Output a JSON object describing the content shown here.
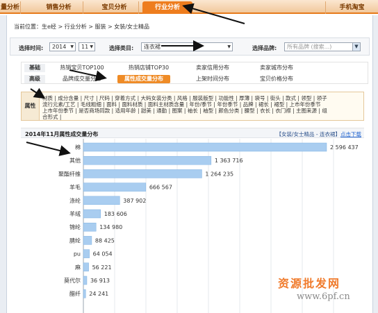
{
  "nav": {
    "tabs": [
      {
        "label": "量分析"
      },
      {
        "label": "销售分析"
      },
      {
        "label": "宝贝分析"
      },
      {
        "label": "行业分析"
      },
      {
        "label": "手机淘宝"
      }
    ]
  },
  "breadcrumb": "当前位置：生e经 > 行业分析 > 服装 > 女装/女士精品",
  "filters": {
    "time_label": "选择时间:",
    "year": "2014",
    "month": "11",
    "category_label": "选择类目:",
    "category": "连衣裙",
    "brand_label": "选择品牌:",
    "brand_placeholder": "所有品牌 (搜索...)"
  },
  "subtabs": {
    "row1": {
      "head": "基础",
      "items": [
        "热销宝贝TOP100",
        "热销店铺TOP30",
        "卖家信用分布",
        "卖家城市分布"
      ]
    },
    "row2": {
      "head": "高级",
      "items": [
        "品牌成交量分布",
        "属性成交量分布",
        "上架时间分布",
        "宝贝价格分布"
      ]
    }
  },
  "attributes": {
    "head": "属性",
    "lines": [
      "材质 | 成分含量 | 尺寸 | 尺码 | 穿着方式 | 大码女装分类 | 风格 | 服装版型 | 功能性 | 厚薄 | 袋号 | 街头 | 款式 | 领型 | 领子",
      "流行元素/工艺 | 毛线粗细 | 面料 | 面料材质 | 面料主材质含量 | 年份/季节 | 年份季节 | 品牌 | 裙长 | 裙型 | 上市年份季节",
      "上市年份季节 | 是否商场同款 | 适用年龄 | 甜美 | 通勤 | 图案 | 袖长 | 袖型 | 颜色分类 | 腰型 | 衣长 | 衣门襟 | 主图来源 | 组",
      "合形式 |"
    ]
  },
  "chart": {
    "title": "2014年11月属性成交量分布",
    "subtitle": "【女装/女士精品 - 连衣裙】",
    "download": "点击下载"
  },
  "chart_data": {
    "type": "bar",
    "orientation": "horizontal",
    "title": "2014年11月属性成交量分布",
    "categories": [
      "棉",
      "其他",
      "聚酯纤维",
      "羊毛",
      "涤纶",
      "羊绒",
      "锦纶",
      "腈纶",
      "pu",
      "麻",
      "莫代尔",
      "醋纤"
    ],
    "values": [
      2596437,
      1363716,
      1264235,
      666567,
      387902,
      183606,
      134980,
      88425,
      64054,
      56221,
      36913,
      24241
    ],
    "value_labels": [
      "2 596 437",
      "1 363 716",
      "1 264 235",
      "666 567",
      "387 902",
      "183 606",
      "134 980",
      "88 425",
      "64 054",
      "56 221",
      "36 913",
      "24 241"
    ],
    "bar_color": "#a9cdf0",
    "grid": true
  },
  "watermark": {
    "line1": "资源批发网",
    "line2": "www.6pf.cn"
  }
}
